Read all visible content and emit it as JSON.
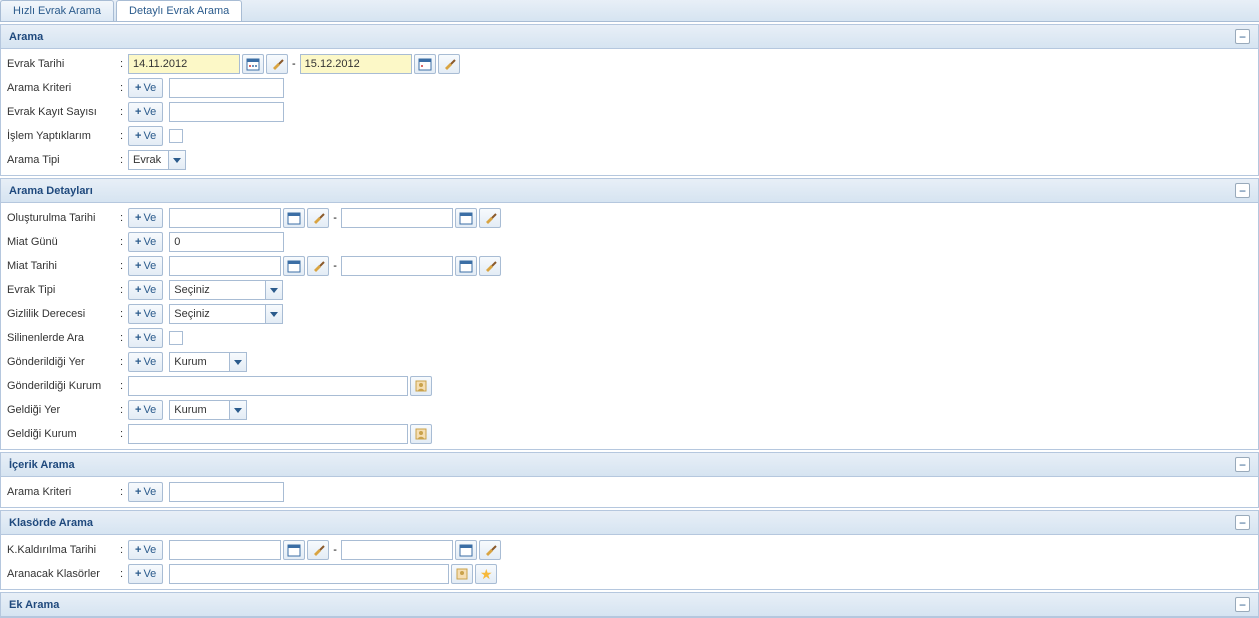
{
  "tabs": {
    "quick": "Hızlı Evrak Arama",
    "detail": "Detaylı Evrak Arama"
  },
  "btn": {
    "and": "Ve"
  },
  "panels": {
    "arama": "Arama",
    "aramaDetay": "Arama Detayları",
    "icerik": "İçerik Arama",
    "klasor": "Klasörde Arama",
    "ek": "Ek Arama"
  },
  "labels": {
    "evrakTarihi": "Evrak Tarihi",
    "aramaKriteri": "Arama Kriteri",
    "evrakKayitSayisi": "Evrak Kayıt Sayısı",
    "islemYaptiklarim": "İşlem Yaptıklarım",
    "aramaTipi": "Arama Tipi",
    "olusturulmaTarihi": "Oluşturulma Tarihi",
    "miatGunu": "Miat Günü",
    "miatTarihi": "Miat Tarihi",
    "evrakTipi": "Evrak Tipi",
    "gizlilik": "Gizlilik Derecesi",
    "silinenlerde": "Silinenlerde Ara",
    "gonderildigiYer": "Gönderildiği Yer",
    "gonderildigiKurum": "Gönderildiği Kurum",
    "geldigiYer": "Geldiği Yer",
    "geldigiKurum": "Geldiği Kurum",
    "kaldirilmaTarihi": "K.Kaldırılma Tarihi",
    "aranacakKlasorler": "Aranacak Klasörler"
  },
  "values": {
    "dateFrom": "14.11.2012",
    "dateTo": "15.12.2012",
    "aramaTipi": "Evrak",
    "miatGunu": "0",
    "seciniz": "Seçiniz",
    "kurum": "Kurum"
  }
}
